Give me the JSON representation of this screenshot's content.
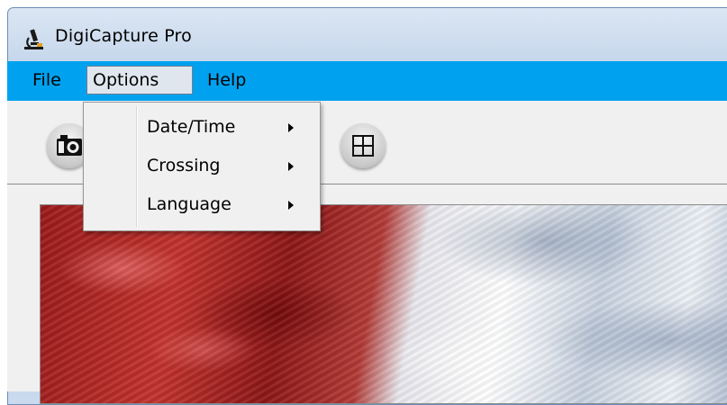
{
  "window": {
    "title": "DigiCapture Pro"
  },
  "menubar": {
    "items": [
      {
        "label": "File"
      },
      {
        "label": "Options"
      },
      {
        "label": "Help"
      }
    ],
    "open_menu": "Options",
    "accent": "#00a2ef"
  },
  "toolbar": {
    "buttons": [
      {
        "icon": "camera-icon"
      },
      {
        "icon": "grid-icon"
      }
    ]
  },
  "options_menu": {
    "items": [
      {
        "label": "Date/Time",
        "has_submenu": true
      },
      {
        "label": "Crossing",
        "has_submenu": true
      },
      {
        "label": "Language",
        "has_submenu": true
      }
    ]
  }
}
